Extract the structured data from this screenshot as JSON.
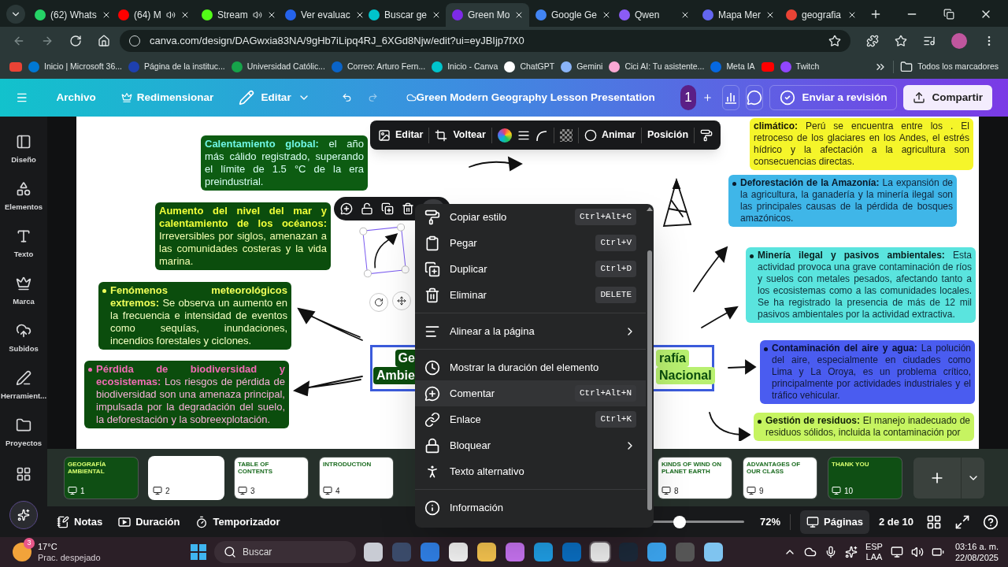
{
  "browser": {
    "tabs": [
      {
        "title": "(62) Whats",
        "audio": false,
        "selected": false
      },
      {
        "title": "(64) M",
        "audio": true,
        "selected": false
      },
      {
        "title": "Stream",
        "audio": true,
        "selected": false
      },
      {
        "title": "Ver evaluac",
        "audio": false,
        "selected": false
      },
      {
        "title": "Buscar ge",
        "audio": false,
        "selected": false
      },
      {
        "title": "Green Mo",
        "audio": false,
        "selected": true
      },
      {
        "title": "Google Ge",
        "audio": false,
        "selected": false
      },
      {
        "title": "Qwen",
        "audio": false,
        "selected": false
      },
      {
        "title": "Mapa Mer",
        "audio": false,
        "selected": false
      },
      {
        "title": "geografia",
        "audio": false,
        "selected": false
      }
    ],
    "address": "canva.com/design/DAGwxia83NA/9gHb7iLipq4RJ_6XGd8Njw/edit?ui=eyJBIjp7fX0",
    "bookmarks": [
      "Inicio | Microsoft 36...",
      "Página de la instituc...",
      "Universidad Católic...",
      "Correo: Arturo Fern...",
      "Inicio - Canva",
      "ChatGPT",
      "Gemini",
      "Cici AI: Tu asistente...",
      "Meta IA",
      "Twitch"
    ],
    "all_bookmarks": "Todos los marcadores"
  },
  "header": {
    "file": "Archivo",
    "resize": "Redimensionar",
    "edit": "Editar",
    "title": "Green Modern Geography Lesson Presentation",
    "collaborators": "1",
    "review": "Enviar a revisión",
    "share": "Compartir"
  },
  "sidebar": {
    "items": [
      "Diseño",
      "Elementos",
      "Texto",
      "Marca",
      "Subidos",
      "Herramient...",
      "Proyectos"
    ]
  },
  "toolbar": {
    "edit": "Editar",
    "flip": "Voltear",
    "animate": "Animar",
    "position": "Posición"
  },
  "notes": [
    {
      "text": "**Calentamiento global:** el año más cálido registrado, superando el límite de 1.5 °C de la era preindustrial.",
      "color": "#0d5c12",
      "bullet": false
    },
    {
      "text": "**Aumento del nivel del mar y calentamiento de los océanos:** Irreversibles por siglos, amenazan a las comunidades costeras y la vida marina.",
      "color": "#0b4d0d",
      "bullet": false
    },
    {
      "text": "**Fenómenos meteorológicos extremos:** Se observa un aumento en la frecuencia e intensidad de eventos como sequías, inundaciones, incendios forestales y ciclones.",
      "color": "#0b4d0d",
      "bullet": true
    },
    {
      "text": "**Pérdida de biodiversidad y ecosistemas:** Los riesgos de pérdida de biodiversidad son una amenaza principal, impulsada por la degradación del suelo, la deforestación y la sobreexplotación.",
      "color": "#0b4d0d",
      "bullet": true
    },
    {
      "text": "**climático:** Perú se encuentra entre los . El retroceso de los glaciares en los Andes, el estrés hídrico y la afectación a la agricultura son consecuencias directas.",
      "color": "#f5f52a",
      "bullet": false
    },
    {
      "text": "**Deforestación de la Amazonía:** La expansión de la agricultura, la ganadería y la minería ilegal son las principales causas de la pérdida de bosques amazónicos.",
      "color": "#3fb6e8",
      "bullet": true
    },
    {
      "text": "**Minería ilegal y pasivos ambientales:** Esta actividad provoca una grave contaminación de ríos y suelos con metales pesados, afectando tanto a los ecosistemas como a las comunidades locales. Se ha registrado la presencia de más de 12 mil pasivos ambientales por la actividad extractiva.",
      "color": "#5ae4de",
      "bullet": true
    },
    {
      "text": "**Contaminación del aire y agua:** La polución del aire, especialmente en ciudades como Lima y La Oroya, es un problema crítico, principalmente por actividades industriales y el tráfico vehicular.",
      "color": "#4a5cf0",
      "bullet": true
    },
    {
      "text": "**Gestión de residuos:** El manejo inadecuado de residuos sólidos, incluida la contaminación por",
      "color": "#c6f461",
      "bullet": true
    }
  ],
  "title_box": {
    "left": [
      "Ge",
      "Ambie"
    ],
    "right": [
      "rafía",
      "Nacional"
    ]
  },
  "context_menu": {
    "groups": [
      [
        {
          "label": "Copiar estilo",
          "shortcut": "Ctrl+Alt+C",
          "submenu": false,
          "highlighted": false
        },
        {
          "label": "Pegar",
          "shortcut": "Ctrl+V",
          "submenu": false,
          "highlighted": false
        },
        {
          "label": "Duplicar",
          "shortcut": "Ctrl+D",
          "submenu": false,
          "highlighted": false
        },
        {
          "label": "Eliminar",
          "shortcut": "DELETE",
          "submenu": false,
          "highlighted": false
        }
      ],
      [
        {
          "label": "Alinear a la página",
          "submenu": true,
          "highlighted": false
        }
      ],
      [
        {
          "label": "Mostrar la duración del elemento",
          "submenu": false,
          "highlighted": false
        },
        {
          "label": "Comentar",
          "shortcut": "Ctrl+Alt+N",
          "submenu": false,
          "highlighted": true
        },
        {
          "label": "Enlace",
          "shortcut": "Ctrl+K",
          "submenu": false,
          "highlighted": false
        },
        {
          "label": "Bloquear",
          "submenu": true,
          "highlighted": false
        },
        {
          "label": "Texto alternativo",
          "submenu": false,
          "highlighted": false
        }
      ],
      [
        {
          "label": "Información",
          "submenu": false,
          "highlighted": false
        }
      ]
    ]
  },
  "thumbnails": [
    {
      "number": "1",
      "title": "GEOGRAFÍA AMBIENTAL",
      "selected": false
    },
    {
      "number": "2",
      "selected": true
    },
    {
      "number": "3",
      "title": "TABLE OF CONTENTS",
      "selected": false
    },
    {
      "number": "4",
      "title": "INTRODUCTION",
      "selected": false
    },
    {
      "number": "8",
      "title": "KINDS OF WIND ON PLANET EARTH",
      "selected": false
    },
    {
      "number": "9",
      "title": "ADVANTAGES OF OUR CLASS",
      "selected": false
    },
    {
      "number": "10",
      "title": "THANK YOU",
      "selected": false
    }
  ],
  "bottom_bar": {
    "notes": "Notas",
    "duration": "Duración",
    "timer": "Temporizador",
    "zoom": {
      "level": 0.33,
      "reading": "72%"
    },
    "pages": "Páginas",
    "page_count": "2 de 10"
  },
  "taskbar": {
    "weather": {
      "badge": "3",
      "temperature": "17°C",
      "condition": "Prac. despejado"
    },
    "search": {
      "placeholder": "Buscar"
    },
    "language": [
      "ESP",
      "LAA"
    ],
    "time": "03:16 a. m.",
    "date": "22/08/2025"
  }
}
